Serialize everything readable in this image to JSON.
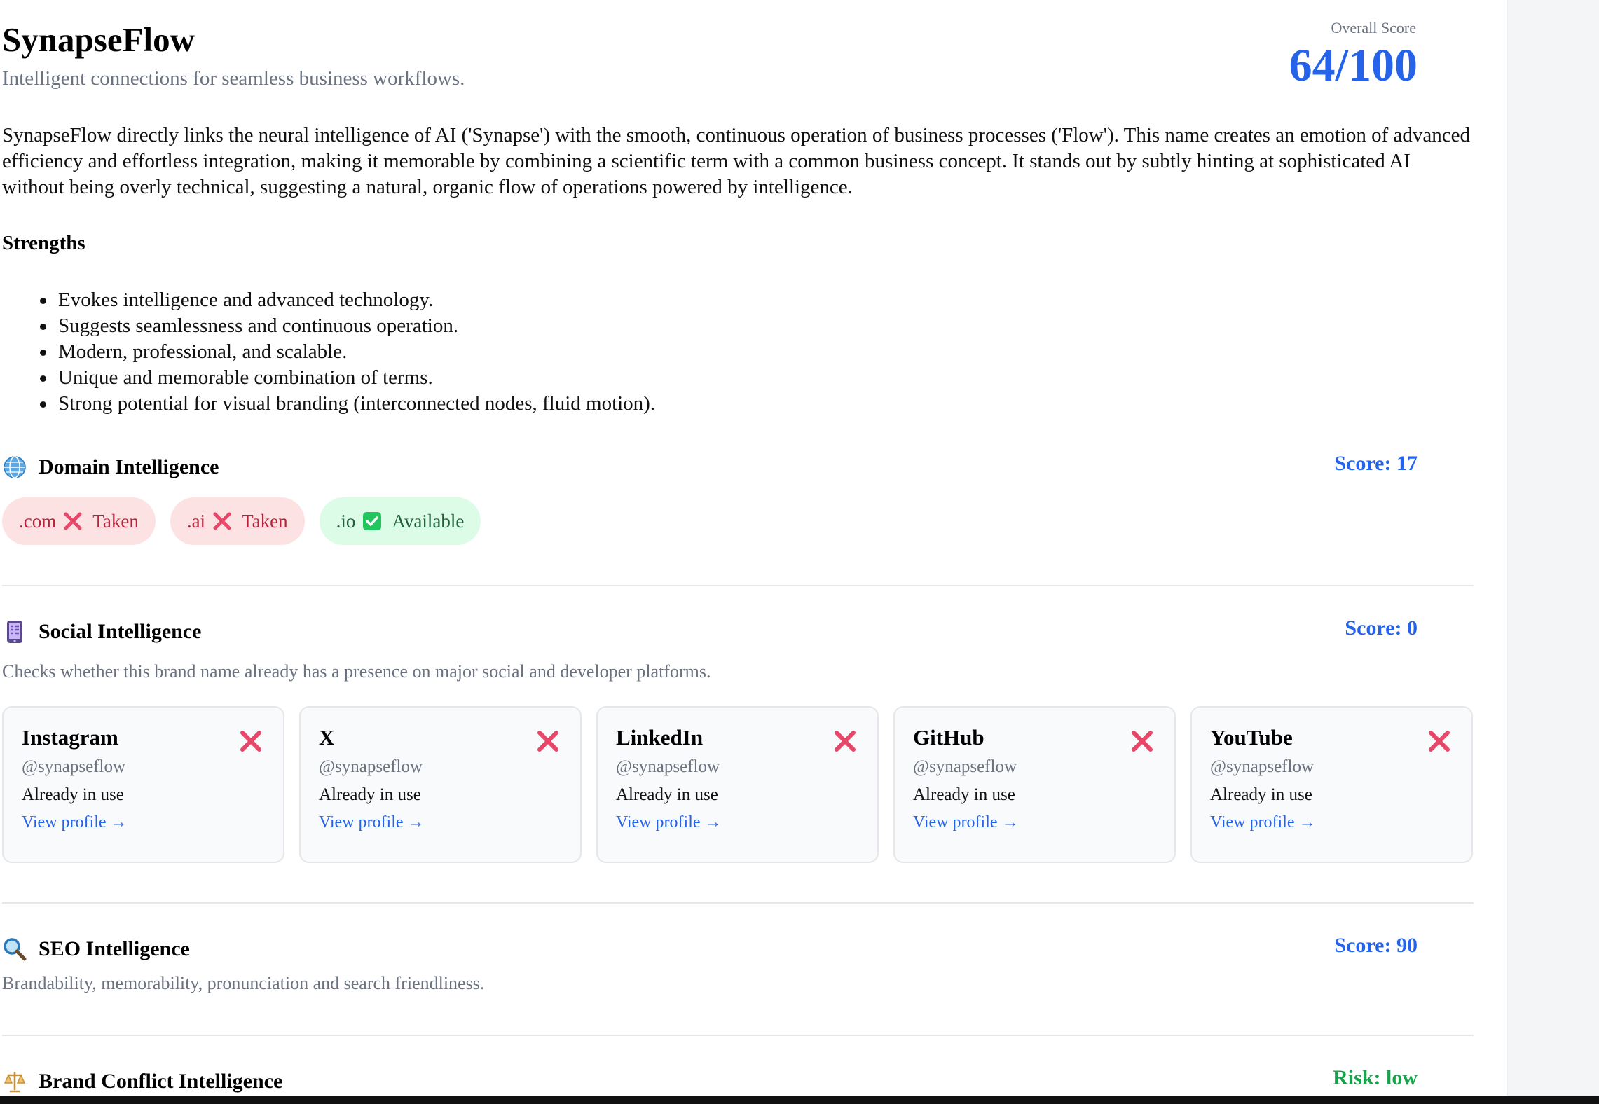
{
  "brand": {
    "name": "SynapseFlow",
    "tagline": "Intelligent connections for seamless business workflows.",
    "overall_label": "Overall Score",
    "overall_score": "64/100"
  },
  "description": "SynapseFlow directly links the neural intelligence of AI ('Synapse') with the smooth, continuous operation of business processes ('Flow'). This name creates an emotion of advanced efficiency and effortless integration, making it memorable by combining a scientific term with a common business concept. It stands out by subtly hinting at sophisticated AI without being overly technical, suggesting a natural, organic flow of operations powered by intelligence.",
  "strengths": {
    "title": "Strengths",
    "items": [
      "Evokes intelligence and advanced technology.",
      "Suggests seamlessness and continuous operation.",
      "Modern, professional, and scalable.",
      "Unique and memorable combination of terms.",
      "Strong potential for visual branding (interconnected nodes, fluid motion)."
    ]
  },
  "domain": {
    "icon": "globe-icon",
    "title": "Domain Intelligence",
    "score": "Score: 17",
    "pills": [
      {
        "tld": ".com",
        "status": "Taken",
        "state": "taken",
        "icon": "cross-mark-icon"
      },
      {
        "tld": ".ai",
        "status": "Taken",
        "state": "taken",
        "icon": "cross-mark-icon"
      },
      {
        "tld": ".io",
        "status": "Available",
        "state": "available",
        "icon": "check-box-icon"
      }
    ]
  },
  "social": {
    "icon": "mobile-phone-icon",
    "title": "Social Intelligence",
    "score": "Score: 0",
    "description": "Checks whether this brand name already has a presence on major social and developer platforms.",
    "cards": [
      {
        "platform": "Instagram",
        "handle": "@synapseflow",
        "status": "Already in use",
        "link": "View profile →"
      },
      {
        "platform": "X",
        "handle": "@synapseflow",
        "status": "Already in use",
        "link": "View profile →"
      },
      {
        "platform": "LinkedIn",
        "handle": "@synapseflow",
        "status": "Already in use",
        "link": "View profile →"
      },
      {
        "platform": "GitHub",
        "handle": "@synapseflow",
        "status": "Already in use",
        "link": "View profile →"
      },
      {
        "platform": "YouTube",
        "handle": "@synapseflow",
        "status": "Already in use",
        "link": "View profile →"
      }
    ]
  },
  "seo": {
    "icon": "magnifier-icon",
    "title": "SEO Intelligence",
    "score": "Score: 90",
    "description": "Brandability, memorability, pronunciation and search friendliness."
  },
  "brand_conflict": {
    "icon": "scales-icon",
    "title": "Brand Conflict Intelligence",
    "risk": "Risk: low"
  },
  "colors": {
    "accent": "#2563eb",
    "taken_bg": "#fde2e4",
    "taken_text": "#b4233a",
    "available_bg": "#dcfce7",
    "cross": "#e8476a",
    "risk_low": "#16a34a"
  }
}
